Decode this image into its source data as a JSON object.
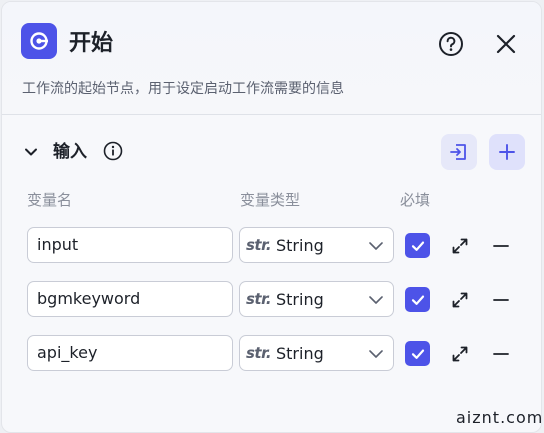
{
  "header": {
    "title": "开始",
    "description": "工作流的起始节点，用于设定启动工作流需要的信息"
  },
  "section": {
    "title": "输入"
  },
  "columns": {
    "name": "变量名",
    "type": "变量类型",
    "required": "必填"
  },
  "variables": [
    {
      "name": "input",
      "type_prefix": "str.",
      "type": "String",
      "required": true
    },
    {
      "name": "bgmkeyword",
      "type_prefix": "str.",
      "type": "String",
      "required": true
    },
    {
      "name": "api_key",
      "type_prefix": "str.",
      "type": "String",
      "required": true
    }
  ],
  "watermark": "aiznt.com",
  "colors": {
    "accent": "#4d53e8",
    "panel_bg": "#f7f8fb",
    "border": "#c9ccd6"
  },
  "icons": {
    "start": "start-node-icon",
    "help": "help-circle-icon",
    "close": "close-icon",
    "collapse": "chevron-down-icon",
    "info": "info-icon",
    "import": "import-icon",
    "add": "plus-icon",
    "expand": "expand-icon",
    "remove": "minus-icon"
  }
}
